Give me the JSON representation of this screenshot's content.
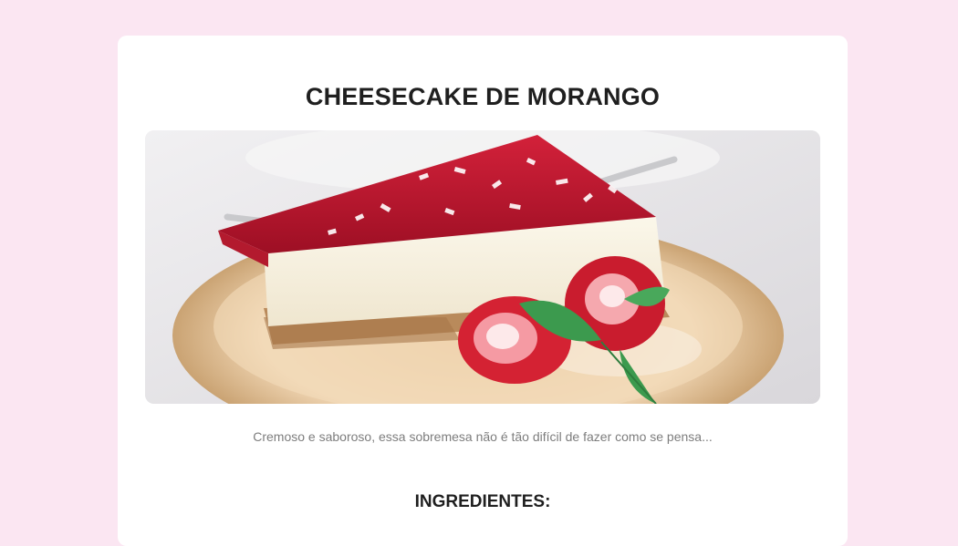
{
  "recipe": {
    "title": "CHEESECAKE DE MORANGO",
    "description": "Cremoso e saboroso, essa sobremesa não é tão difícil de fazer como se pensa...",
    "ingredients_heading": "INGREDIENTES:"
  },
  "colors": {
    "page_background": "#fbe6f2",
    "card_background": "#ffffff",
    "title_text": "#1f1f1f",
    "description_text": "#7d7d7d"
  }
}
